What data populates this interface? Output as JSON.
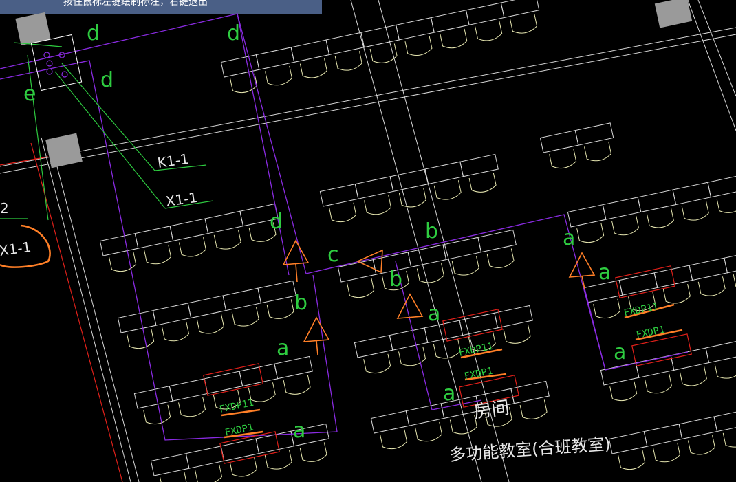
{
  "status_tip": "按住鼠标左键绘制标注，右键退出",
  "section_labels": [
    "d",
    "d",
    "d",
    "e",
    "d",
    "b",
    "c",
    "b",
    "b",
    "a",
    "a",
    "a",
    "a",
    "a",
    "a",
    "a"
  ],
  "circuit_labels": {
    "k1": "K1-1",
    "x1": "X1-1",
    "left_x1": "X1-1",
    "two": "2"
  },
  "fixtures": {
    "label": "FXDP11",
    "label_alt": "FXDP1",
    "label_bot": "FXDP11"
  },
  "room": {
    "name_top": "房间",
    "name_bottom": "多功能教室(合班教室)"
  },
  "colors": {
    "background": "#000000",
    "tip_bar": "#4a5f86",
    "label_green": "#2ecc40",
    "partition_purple": "#8a2be2",
    "fixture_red": "#e0201a",
    "arrow_orange": "#ff7f27",
    "furniture": "#e6e6b0"
  }
}
